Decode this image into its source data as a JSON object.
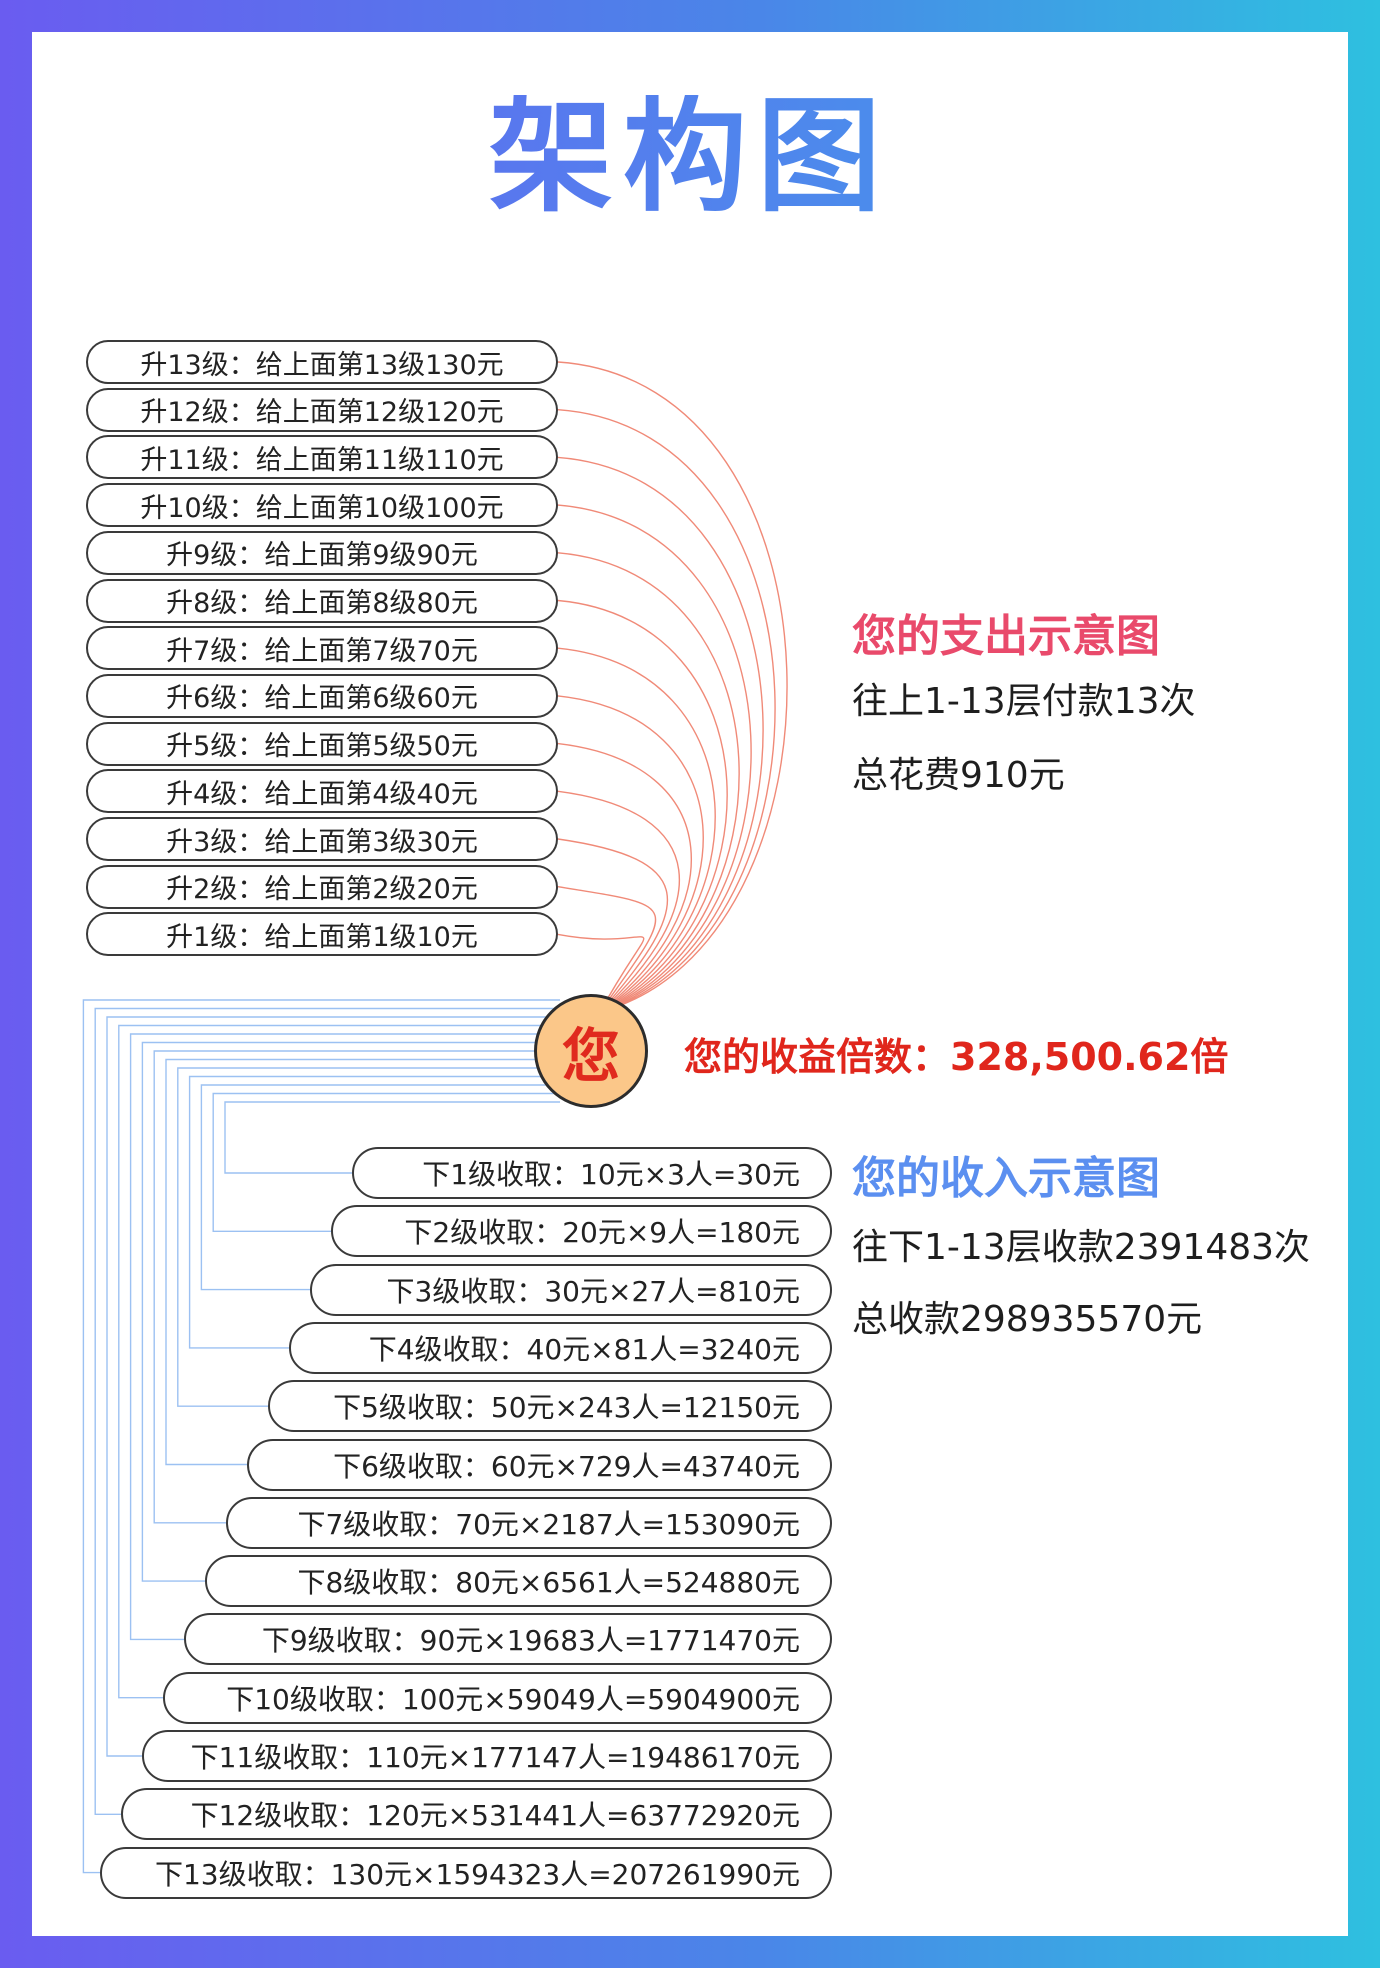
{
  "title": "架构图",
  "center_label": "您",
  "upgrade_items": [
    "升13级：给上面第13级130元",
    "升12级：给上面第12级120元",
    "升11级：给上面第11级110元",
    "升10级：给上面第10级100元",
    "升9级：给上面第9级90元",
    "升8级：给上面第8级80元",
    "升7级：给上面第7级70元",
    "升6级：给上面第6级60元",
    "升5级：给上面第5级50元",
    "升4级：给上面第4级40元",
    "升3级：给上面第3级30元",
    "升2级：给上面第2级20元",
    "升1级：给上面第1级10元"
  ],
  "income_items": [
    "下1级收取：10元×3人=30元",
    "下2级收取：20元×9人=180元",
    "下3级收取：30元×27人=810元",
    "下4级收取：40元×81人=3240元",
    "下5级收取：50元×243人=12150元",
    "下6级收取：60元×729人=43740元",
    "下7级收取：70元×2187人=153090元",
    "下8级收取：80元×6561人=524880元",
    "下9级收取：90元×19683人=1771470元",
    "下10级收取：100元×59049人=5904900元",
    "下11级收取：110元×177147人=19486170元",
    "下12级收取：120元×531441人=63772920元",
    "下13级收取：130元×1594323人=207261990元"
  ],
  "expense_section": {
    "heading": "您的支出示意图",
    "line1": "往上1-13层付款13次",
    "line2": "总花费910元"
  },
  "multiplier_text": "您的收益倍数：328,500.62倍",
  "income_section": {
    "heading": "您的收入示意图",
    "line1": "往下1-13层收款2391483次",
    "line2": "总收款298935570元"
  },
  "colors": {
    "expense_accent": "#e94a6b",
    "income_accent": "#5b8ff0",
    "multiplier": "#e0261c",
    "upper_lines": "#f08a78",
    "lower_lines": "#9cc1f2",
    "center_fill": "#fbc789"
  }
}
